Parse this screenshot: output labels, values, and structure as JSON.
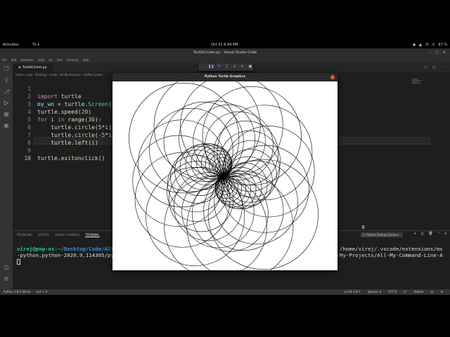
{
  "topbar": {
    "activities": "Activities",
    "app_menu": "Tk ▾",
    "clock": "Oct 21  6:44 PM",
    "battery": "97 %"
  },
  "window_title": "TurtleCircles.py - Visual Studio Code",
  "menu": [
    "File",
    "Edit",
    "Selection",
    "View",
    "Go",
    "Run",
    "Terminal",
    "Help"
  ],
  "editor": {
    "tab_label": "TurtleCircles.py",
    "breadcrumb": "home › virej › Desktop › Code › All-My-Projects › All-My-Comm...",
    "line_numbers": [
      "1",
      "2",
      "3",
      "4",
      "5",
      "6",
      "7",
      "8",
      "9",
      "10"
    ],
    "active_line": 10
  },
  "panel": {
    "tabs": [
      "PROBLEMS",
      "OUTPUT",
      "DEBUG CONSOLE",
      "TERMINAL"
    ],
    "active_tab": "TERMINAL",
    "terminal_select": "2: Python Debug Conso ▾",
    "terminal": {
      "prompt_user": "virej@pop-os",
      "prompt_path": ":~/Desktop/Code/All",
      "cmd_tail_1": "3 /home/virej/.vscode/extensions/ms",
      "line2_left": "-python.python-2020.9.114305/py",
      "line2_right": "l-My-Projects/All-My-Command-Line-A",
      "line3": "pps/TurtleArt/TurtleCircles.py"
    }
  },
  "statusbar": {
    "python": "Python 3.8.5 64-bit",
    "problems": "⊗ 0 ⚠ 0",
    "position": "Ln 10, Col 1",
    "spaces": "Spaces: 4",
    "encoding": "UTF-8",
    "eol": "LF",
    "language": "Python"
  },
  "turtle": {
    "title": "Python Turtle Graphics",
    "iterations": 30,
    "radius_step": 5,
    "turn_degrees": 1,
    "speed": 20
  }
}
